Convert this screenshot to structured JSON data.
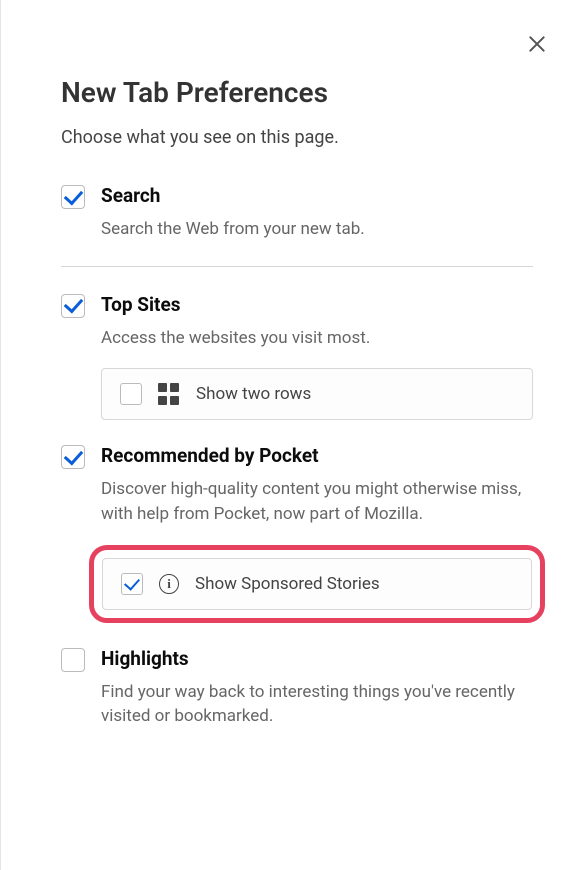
{
  "title": "New Tab Preferences",
  "subtitle": "Choose what you see on this page.",
  "sections": {
    "search": {
      "title": "Search",
      "desc": "Search the Web from your new tab.",
      "checked": true
    },
    "topsites": {
      "title": "Top Sites",
      "desc": "Access the websites you visit most.",
      "checked": true,
      "sub": {
        "label": "Show two rows",
        "checked": false
      }
    },
    "pocket": {
      "title": "Recommended by Pocket",
      "desc": "Discover high-quality content you might otherwise miss, with help from Pocket, now part of Mozilla.",
      "checked": true,
      "sub": {
        "label": "Show Sponsored Stories",
        "checked": true
      }
    },
    "highlights": {
      "title": "Highlights",
      "desc": "Find your way back to interesting things you've recently visited or bookmarked.",
      "checked": false
    }
  }
}
